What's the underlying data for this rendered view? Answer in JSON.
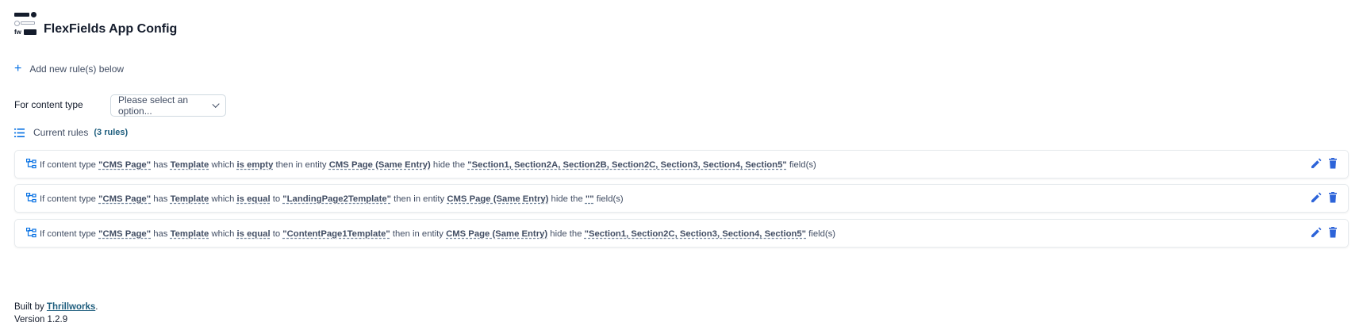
{
  "header": {
    "title": "FlexFields App Config",
    "logo_text": "fw"
  },
  "add_rule": {
    "label": "Add new rule(s) below"
  },
  "content_type": {
    "label": "For content type",
    "select_value": "Please select an option..."
  },
  "current_rules": {
    "label": "Current rules",
    "count": "(3 rules)"
  },
  "rules": [
    {
      "p1": "If content type",
      "ctype": "\"CMS Page\"",
      "p2": "has",
      "field": "Template",
      "p3": "which",
      "op": "is empty",
      "p4": "",
      "value": "",
      "p5": "then in entity",
      "entity": "CMS Page (Same Entry)",
      "p6": "hide the",
      "fields": "\"Section1, Section2A, Section2B, Section2C, Section3, Section4, Section5\"",
      "p7": "field(s)"
    },
    {
      "p1": "If content type",
      "ctype": "\"CMS Page\"",
      "p2": "has",
      "field": "Template",
      "p3": "which",
      "op": "is equal",
      "p4": "to",
      "value": "\"LandingPage2Template\"",
      "p5": "then in entity",
      "entity": "CMS Page (Same Entry)",
      "p6": "hide the",
      "fields": "\"\"",
      "p7": "field(s)"
    },
    {
      "p1": "If content type",
      "ctype": "\"CMS Page\"",
      "p2": "has",
      "field": "Template",
      "p3": "which",
      "op": "is equal",
      "p4": "to",
      "value": "\"ContentPage1Template\"",
      "p5": "then in entity",
      "entity": "CMS Page (Same Entry)",
      "p6": "hide the",
      "fields": "\"Section1, Section2C, Section3, Section4, Section5\"",
      "p7": "field(s)"
    }
  ],
  "footer": {
    "built_by": "Built by",
    "author": "Thrillworks",
    "period": ".",
    "version": "Version 1.2.9"
  },
  "colors": {
    "accent": "#036fe3",
    "delete": "#2d64d9",
    "text": "#414d63",
    "heading": "#141c2c"
  },
  "icons": {
    "add": "plus-icon",
    "list": "list-icon",
    "rule": "flow-icon",
    "edit": "pencil-icon",
    "delete": "trash-icon",
    "select": "chevron-down-icon"
  }
}
